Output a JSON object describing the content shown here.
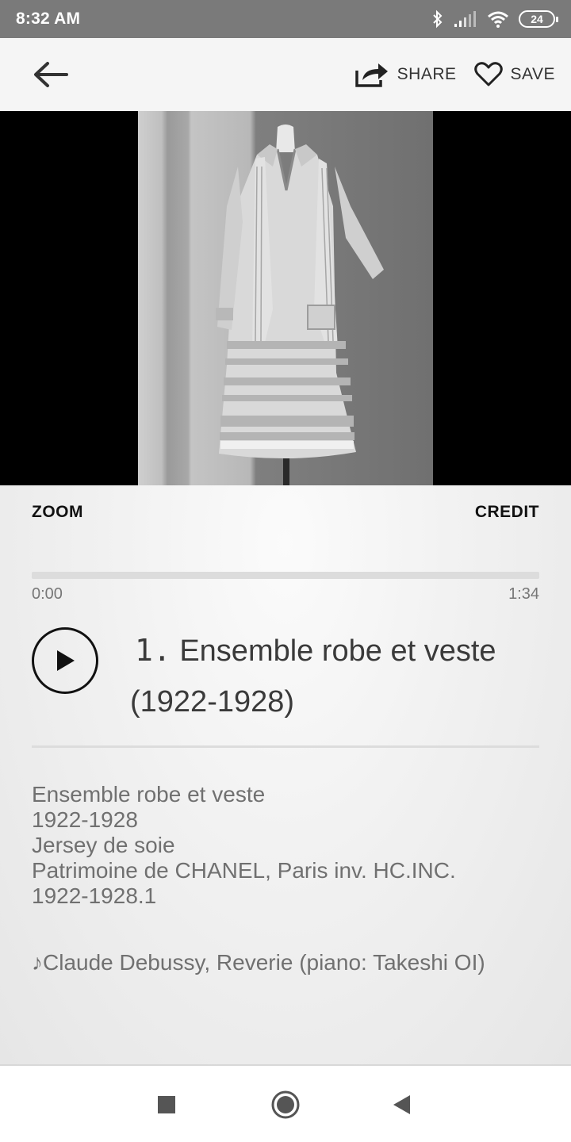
{
  "status_bar": {
    "time": "8:32 AM",
    "battery": "24",
    "icons": [
      "bluetooth-icon",
      "signal-icon",
      "wifi-icon",
      "battery-icon"
    ]
  },
  "toolbar": {
    "share_label": "SHARE",
    "save_label": "SAVE",
    "icons": [
      "back-arrow-icon",
      "share-icon",
      "heart-icon"
    ]
  },
  "artwork": {
    "description": "photograph of dress on mannequin"
  },
  "actions": {
    "zoom_label": "ZOOM",
    "credit_label": "CREDIT"
  },
  "audio": {
    "current_time": "0:00",
    "total_time": "1:34",
    "progress": 0
  },
  "track": {
    "number": "1.",
    "title": "Ensemble robe et veste　(1922-1928)"
  },
  "description": {
    "lines": [
      "Ensemble robe et veste",
      "1922-1928",
      "Jersey de soie",
      "Patrimoine de CHANEL, Paris inv. HC.INC.",
      "1922-1928.1"
    ],
    "music": "♪Claude Debussy, Reverie (piano: Takeshi OI)"
  },
  "nav_bar": {
    "icons": [
      "recents-square-icon",
      "home-circle-icon",
      "back-triangle-icon"
    ]
  },
  "colors": {
    "status_bar": "#7a7a7a",
    "toolbar_bg": "#f5f5f5",
    "text_primary": "#111111",
    "text_muted": "#707070"
  }
}
